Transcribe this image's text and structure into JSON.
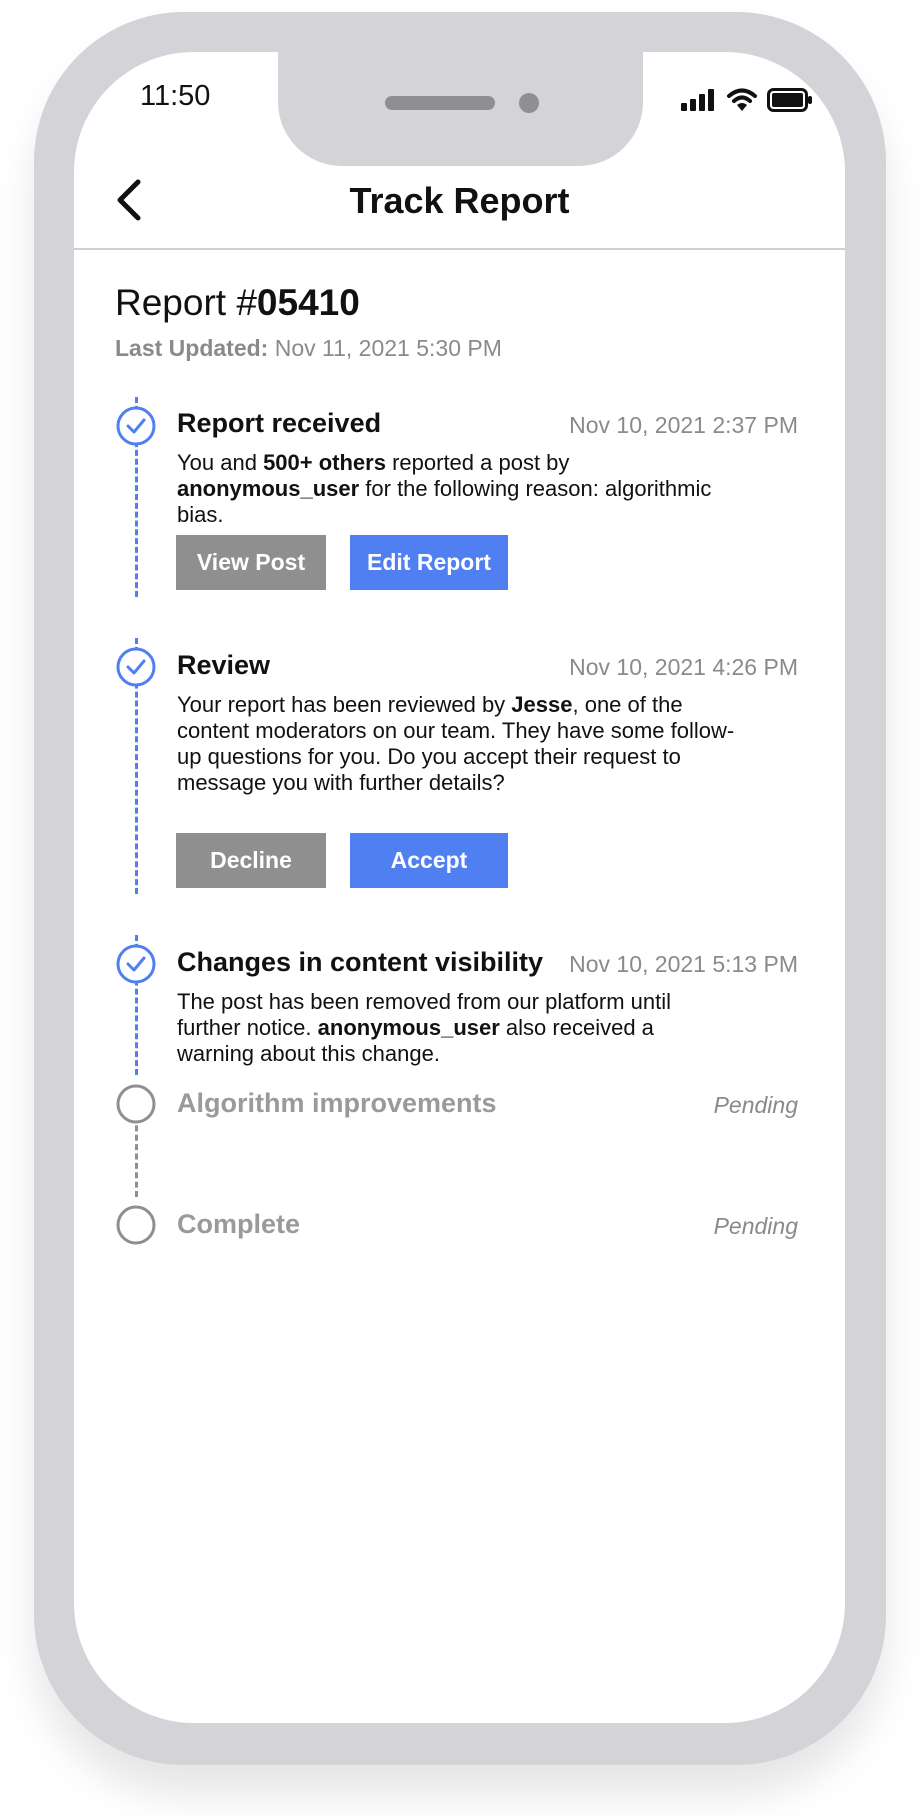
{
  "status_bar": {
    "time": "11:50"
  },
  "header": {
    "title": "Track Report"
  },
  "report": {
    "title_prefix": "Report #",
    "number": "05410",
    "last_updated_label": "Last Updated:",
    "last_updated_value": "Nov 11, 2021  5:30 PM"
  },
  "steps": [
    {
      "title": "Report received",
      "time": "Nov 10, 2021 2:37 PM",
      "status": "done",
      "desc": {
        "t1": "You and ",
        "b1": "500+ others",
        "t2": " reported a post by ",
        "b2": "anonymous_user",
        "t3": " for the following reason: algorithmic bias."
      },
      "buttons": [
        "View Post",
        "Edit Report"
      ]
    },
    {
      "title": "Review",
      "time": "Nov 10, 2021 4:26 PM",
      "status": "done",
      "desc": {
        "t1": "Your report has been reviewed by ",
        "b1": "Jesse",
        "t2": ", one of the content moderators on our team. They have some follow-up questions for you. Do you accept their request to message you with further details?"
      },
      "buttons": [
        "Decline",
        "Accept"
      ]
    },
    {
      "title": "Changes in content visibility",
      "time": "Nov 10, 2021 5:13 PM",
      "status": "done",
      "desc": {
        "t1": "The post has been removed from our platform until further notice. ",
        "b1": "anonymous_user",
        "t2": " also received a warning about this change."
      }
    },
    {
      "title": "Algorithm improvements",
      "time": "Pending",
      "status": "pending"
    },
    {
      "title": "Complete",
      "time": "Pending",
      "status": "pending"
    }
  ],
  "colors": {
    "accent": "#4f7ff0",
    "muted_button": "#8f8f8f",
    "frame": "#d3d3d8"
  },
  "icons": [
    "back-chevron-icon",
    "signal-icon",
    "wifi-icon",
    "battery-icon",
    "check-circle-icon",
    "empty-circle-icon"
  ]
}
